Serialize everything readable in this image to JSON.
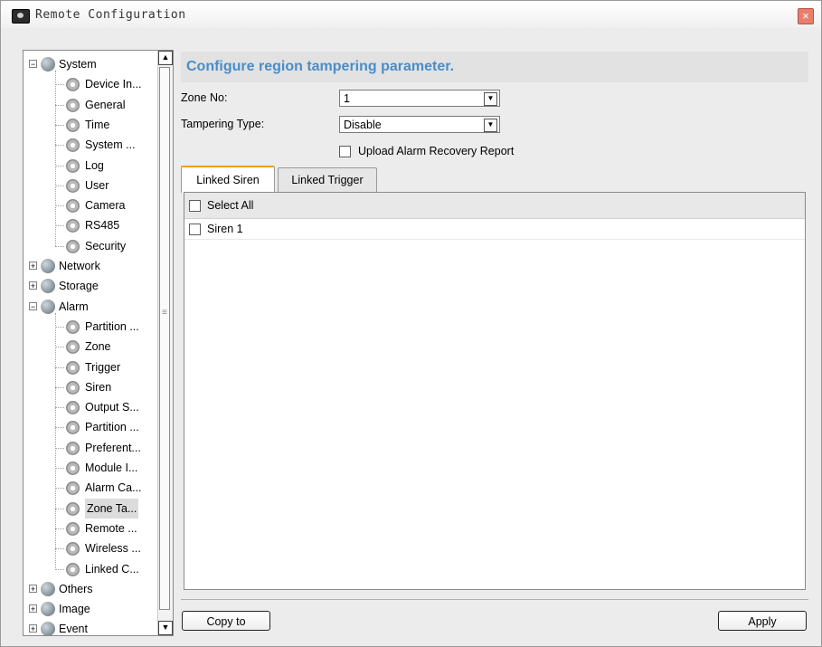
{
  "window": {
    "title": "Remote Configuration"
  },
  "tree": [
    {
      "label": "System",
      "type": "group",
      "expanded": true,
      "level": 0,
      "icon": "globe-icon"
    },
    {
      "label": "Device In...",
      "type": "item",
      "level": 1,
      "icon": "gear-icon"
    },
    {
      "label": "General",
      "type": "item",
      "level": 1,
      "icon": "gear-icon"
    },
    {
      "label": "Time",
      "type": "item",
      "level": 1,
      "icon": "gear-icon"
    },
    {
      "label": "System ...",
      "type": "item",
      "level": 1,
      "icon": "gear-icon"
    },
    {
      "label": "Log",
      "type": "item",
      "level": 1,
      "icon": "gear-icon"
    },
    {
      "label": "User",
      "type": "item",
      "level": 1,
      "icon": "gear-icon"
    },
    {
      "label": "Camera",
      "type": "item",
      "level": 1,
      "icon": "gear-icon"
    },
    {
      "label": "RS485",
      "type": "item",
      "level": 1,
      "icon": "gear-icon"
    },
    {
      "label": "Security",
      "type": "item",
      "level": 1,
      "icon": "gear-icon"
    },
    {
      "label": "Network",
      "type": "group",
      "expanded": false,
      "level": 0,
      "icon": "globe-icon"
    },
    {
      "label": "Storage",
      "type": "group",
      "expanded": false,
      "level": 0,
      "icon": "globe-icon"
    },
    {
      "label": "Alarm",
      "type": "group",
      "expanded": true,
      "level": 0,
      "icon": "globe-icon"
    },
    {
      "label": "Partition ...",
      "type": "item",
      "level": 1,
      "icon": "gear-icon"
    },
    {
      "label": "Zone",
      "type": "item",
      "level": 1,
      "icon": "gear-icon"
    },
    {
      "label": "Trigger",
      "type": "item",
      "level": 1,
      "icon": "gear-icon"
    },
    {
      "label": "Siren",
      "type": "item",
      "level": 1,
      "icon": "gear-icon"
    },
    {
      "label": "Output S...",
      "type": "item",
      "level": 1,
      "icon": "gear-icon"
    },
    {
      "label": "Partition ...",
      "type": "item",
      "level": 1,
      "icon": "gear-icon"
    },
    {
      "label": "Preferent...",
      "type": "item",
      "level": 1,
      "icon": "gear-icon"
    },
    {
      "label": "Module I...",
      "type": "item",
      "level": 1,
      "icon": "gear-icon"
    },
    {
      "label": "Alarm Ca...",
      "type": "item",
      "level": 1,
      "icon": "gear-icon"
    },
    {
      "label": "Zone Ta...",
      "type": "item",
      "level": 1,
      "icon": "gear-icon",
      "selected": true
    },
    {
      "label": "Remote ...",
      "type": "item",
      "level": 1,
      "icon": "gear-icon"
    },
    {
      "label": "Wireless ...",
      "type": "item",
      "level": 1,
      "icon": "gear-icon"
    },
    {
      "label": "Linked C...",
      "type": "item",
      "level": 1,
      "icon": "gear-icon"
    },
    {
      "label": "Others",
      "type": "group",
      "expanded": false,
      "level": 0,
      "icon": "globe-icon"
    },
    {
      "label": "Image",
      "type": "group",
      "expanded": false,
      "level": 0,
      "icon": "globe-icon"
    },
    {
      "label": "Event",
      "type": "group",
      "expanded": false,
      "level": 0,
      "icon": "globe-icon"
    }
  ],
  "main": {
    "heading": "Configure region tampering parameter.",
    "zone_no": {
      "label": "Zone No:",
      "value": "1"
    },
    "tampering_type": {
      "label": "Tampering Type:",
      "value": "Disable"
    },
    "upload_report": {
      "label": "Upload Alarm Recovery Report",
      "checked": false
    },
    "tabs": [
      {
        "label": "Linked Siren",
        "active": true
      },
      {
        "label": "Linked Trigger",
        "active": false
      }
    ],
    "list": {
      "select_all": {
        "label": "Select All",
        "checked": false
      },
      "rows": [
        {
          "label": "Siren 1",
          "checked": false
        }
      ]
    },
    "buttons": {
      "copy_to": "Copy to",
      "apply": "Apply"
    }
  },
  "colors": {
    "heading_blue": "#4a8dc8",
    "tab_accent": "#f0a000",
    "close_red": "#e87f6e"
  }
}
